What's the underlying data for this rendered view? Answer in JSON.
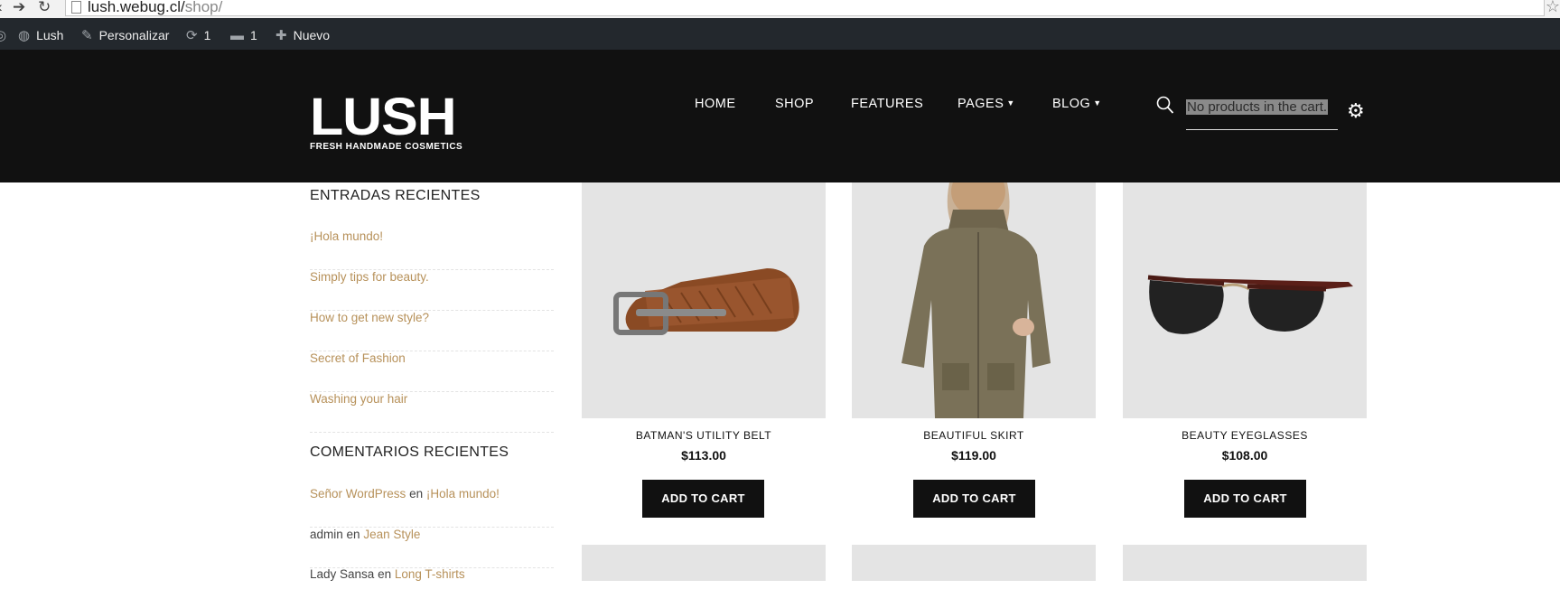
{
  "browser": {
    "url_host": "lush.webug.cl/",
    "url_path": "shop/"
  },
  "adminbar": {
    "site_name": "Lush",
    "customize": "Personalizar",
    "updates_count": "1",
    "comments_count": "1",
    "new_label": "Nuevo"
  },
  "header": {
    "logo_word": "LUSH",
    "logo_tagline": "FRESH HANDMADE COSMETICS",
    "menu": [
      "HOME",
      "SHOP",
      "FEATURES",
      "PAGES",
      "BLOG"
    ],
    "cart_text": "No products in the cart."
  },
  "sidebar": {
    "recent_posts_title": "ENTRADAS RECIENTES",
    "recent_posts": [
      "¡Hola mundo!",
      "Simply tips for beauty.",
      "How to get new style?",
      "Secret of Fashion",
      "Washing your hair"
    ],
    "recent_comments_title": "COMENTARIOS RECIENTES",
    "recent_comments": [
      {
        "author": "Señor WordPress",
        "connector": "en",
        "post": "¡Hola mundo!"
      },
      {
        "author": "admin",
        "connector": "en",
        "post": "Jean Style"
      },
      {
        "author": "Lady Sansa",
        "connector": "en",
        "post": "Long T-shirts"
      }
    ]
  },
  "products": [
    {
      "name": "BATMAN'S UTILITY BELT",
      "price": "$113.00",
      "button": "ADD TO CART",
      "image": "belt"
    },
    {
      "name": "BEAUTIFUL SKIRT",
      "price": "$119.00",
      "button": "ADD TO CART",
      "image": "woman-in-jacket"
    },
    {
      "name": "BEAUTY EYEGLASSES",
      "price": "$108.00",
      "button": "ADD TO CART",
      "image": "sunglasses"
    }
  ]
}
